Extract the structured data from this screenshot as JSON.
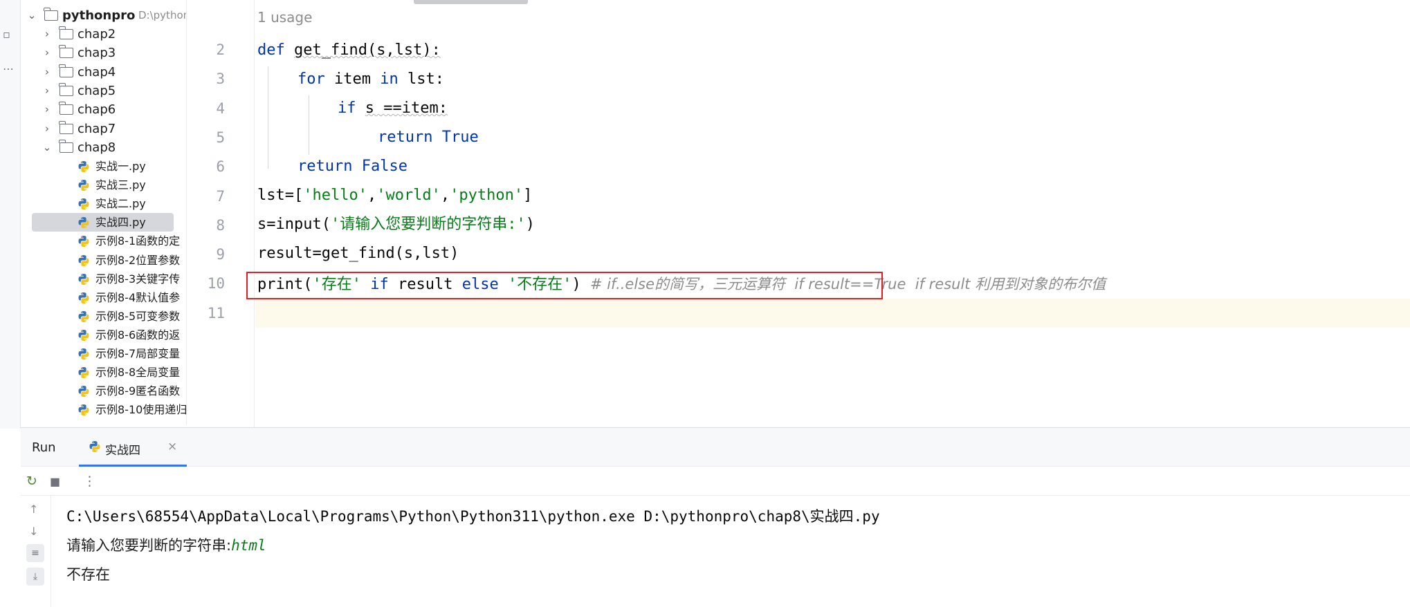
{
  "project": {
    "root_name": "pythonpro",
    "root_path": "D:\\pythonpro",
    "folders": [
      "chap2",
      "chap3",
      "chap4",
      "chap5",
      "chap6",
      "chap7"
    ],
    "open_folder": "chap8",
    "files": [
      "实战一.py",
      "实战三.py",
      "实战二.py",
      "实战四.py",
      "示例8-1函数的定",
      "示例8-2位置参数",
      "示例8-3关键字传",
      "示例8-4默认值参",
      "示例8-5可变参数",
      "示例8-6函数的返",
      "示例8-7局部变量",
      "示例8-8全局变量",
      "示例8-9匿名函数",
      "示例8-10使用递归"
    ],
    "selected_file": "实战四.py"
  },
  "editor": {
    "usage_hint": "1 usage",
    "line_numbers": [
      "2",
      "3",
      "4",
      "5",
      "6",
      "7",
      "8",
      "9",
      "10",
      "11"
    ],
    "code": {
      "l2_def": "def ",
      "l2_name": "get_find(s,lst):",
      "l3_for": "for ",
      "l3_item": "item ",
      "l3_in": "in ",
      "l3_rest": "lst:",
      "l4_if": "if ",
      "l4_rest": "s ==item:",
      "l5_return": "return ",
      "l5_true": "True",
      "l6_return": "return ",
      "l6_false": "False",
      "l7_a": "lst=[",
      "l7_s1": "'hello'",
      "l7_c1": ",",
      "l7_s2": "'world'",
      "l7_c2": ",",
      "l7_s3": "'python'",
      "l7_b": "]",
      "l8_a": "s=input(",
      "l8_s": "'请输入您要判断的字符串:'",
      "l8_b": ")",
      "l9": "result=get_find(s,lst)",
      "l10_print": "print(",
      "l10_s1": "'存在' ",
      "l10_if": "if ",
      "l10_result": "result ",
      "l10_else": "else ",
      "l10_s2": "'不存在'",
      "l10_close": ") ",
      "l10_comment": "# if..else的简写，三元运算符  if result==True  if result 利用到对象的布尔值"
    }
  },
  "run": {
    "panel_title": "Run",
    "tab_label": "实战四",
    "output_cmd": "C:\\Users\\68554\\AppData\\Local\\Programs\\Python\\Python311\\python.exe D:\\pythonpro\\chap8\\实战四.py",
    "prompt": "请输入您要判断的字符串:",
    "user_input": "html",
    "result": "不存在"
  }
}
